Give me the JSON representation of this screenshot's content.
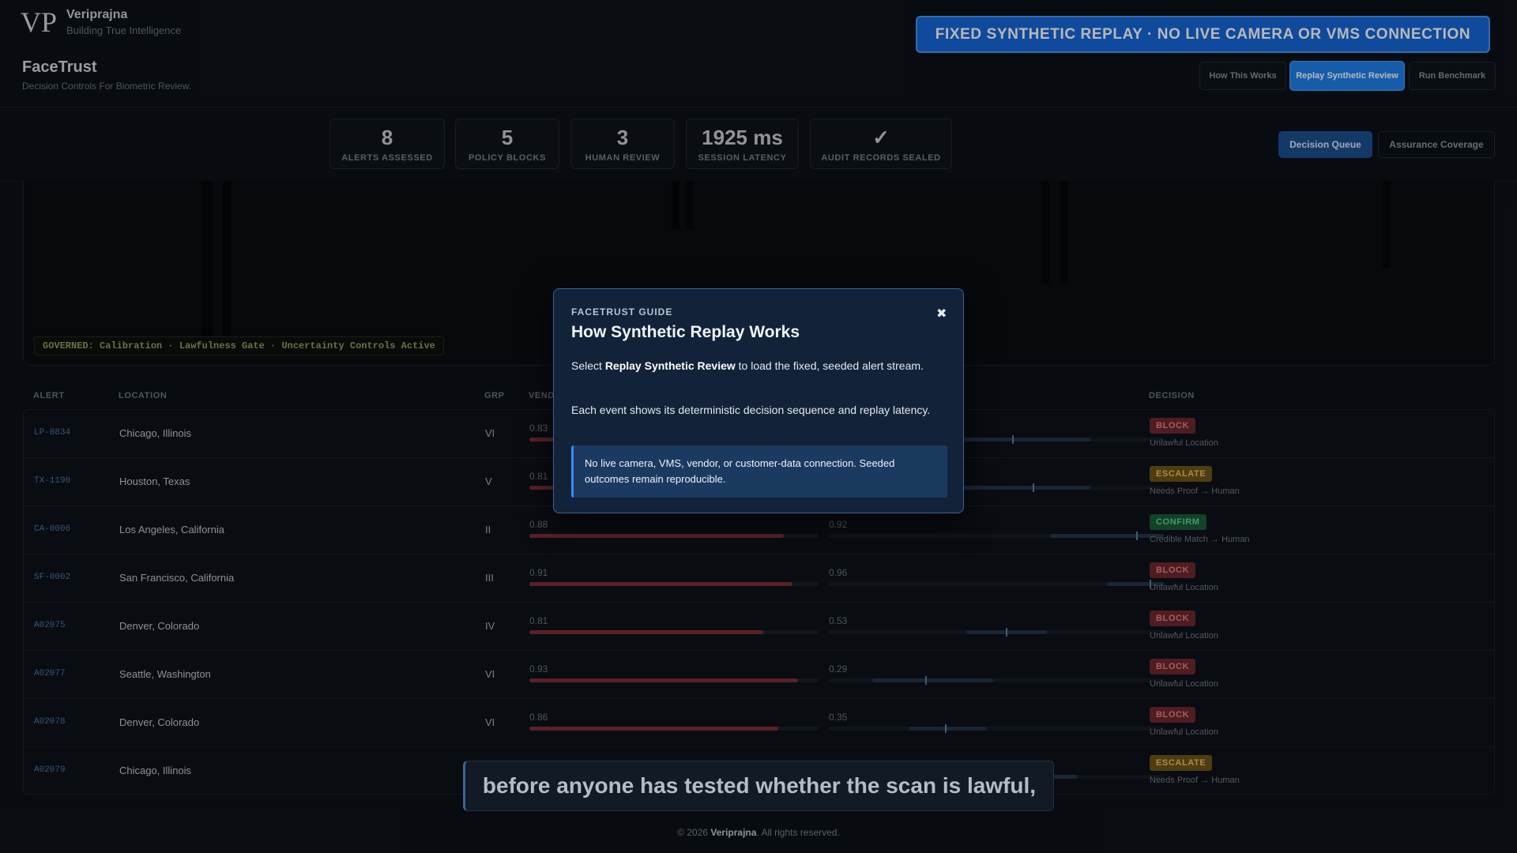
{
  "brand": {
    "name": "Veriprajna",
    "tagline": "Building True Intelligence",
    "logo_text": "VP"
  },
  "notice": "FIXED SYNTHETIC REPLAY · NO LIVE CAMERA OR VMS CONNECTION",
  "app": {
    "title": "FaceTrust",
    "subtitle": "Decision Controls For Biometric Review."
  },
  "top_nav": {
    "how": "How This Works",
    "replay": "Replay Synthetic Review",
    "bench": "Run Benchmark"
  },
  "stats": [
    {
      "value": "8",
      "label": "ALERTS ASSESSED"
    },
    {
      "value": "5",
      "label": "POLICY BLOCKS"
    },
    {
      "value": "3",
      "label": "HUMAN REVIEW"
    },
    {
      "value": "1925 ms",
      "label": "SESSION LATENCY"
    },
    {
      "value": "✓",
      "label": "AUDIT RECORDS SEALED"
    }
  ],
  "views": {
    "queue": "Decision Queue",
    "coverage": "Assurance Coverage"
  },
  "governed": "GOVERNED: Calibration · Lawfulness Gate · Uncertainty Controls Active",
  "table": {
    "headers": {
      "alert": "ALERT",
      "location": "LOCATION",
      "grp": "GRP",
      "vendor": "VEND",
      "decision": "DECISION"
    },
    "rows": [
      {
        "id": "LP-0834",
        "location": "Chicago, Illinois",
        "grp": "VI",
        "vendor": 0.83,
        "vendor_text": "0.83",
        "unc_text": "",
        "unc": 0.55,
        "unc_range": [
          0.3,
          0.78
        ],
        "decision": "BLOCK",
        "kind": "block",
        "reason": "Unlawful Location"
      },
      {
        "id": "TX-1190",
        "location": "Houston, Texas",
        "grp": "V",
        "vendor": 0.81,
        "vendor_text": "0.81",
        "unc_text": "",
        "unc": 0.61,
        "unc_range": [
          0.4,
          0.78
        ],
        "decision": "ESCALATE",
        "kind": "escalate",
        "reason": "Needs Proof → Human"
      },
      {
        "id": "CA-0006",
        "location": "Los Angeles, California",
        "grp": "II",
        "vendor": 0.88,
        "vendor_text": "0.88",
        "unc_text": "0.92",
        "unc": 0.92,
        "unc_range": [
          0.66,
          1.0
        ],
        "decision": "CONFIRM",
        "kind": "confirm",
        "reason": "Credible Match → Human"
      },
      {
        "id": "SF-0002",
        "location": "San Francisco, California",
        "grp": "III",
        "vendor": 0.91,
        "vendor_text": "0.91",
        "unc_text": "0.96",
        "unc": 0.96,
        "unc_range": [
          0.83,
          1.0
        ],
        "decision": "BLOCK",
        "kind": "block",
        "reason": "Unlawful Location"
      },
      {
        "id": "A02075",
        "location": "Denver, Colorado",
        "grp": "IV",
        "vendor": 0.81,
        "vendor_text": "0.81",
        "unc_text": "0.53",
        "unc": 0.53,
        "unc_range": [
          0.41,
          0.65
        ],
        "decision": "BLOCK",
        "kind": "block",
        "reason": "Unlawful Location"
      },
      {
        "id": "A02077",
        "location": "Seattle, Washington",
        "grp": "VI",
        "vendor": 0.93,
        "vendor_text": "0.93",
        "unc_text": "0.29",
        "unc": 0.29,
        "unc_range": [
          0.13,
          0.49
        ],
        "decision": "BLOCK",
        "kind": "block",
        "reason": "Unlawful Location"
      },
      {
        "id": "A02078",
        "location": "Denver, Colorado",
        "grp": "VI",
        "vendor": 0.86,
        "vendor_text": "0.86",
        "unc_text": "0.35",
        "unc": 0.35,
        "unc_range": [
          0.24,
          0.47
        ],
        "decision": "BLOCK",
        "kind": "block",
        "reason": "Unlawful Location"
      },
      {
        "id": "A02079",
        "location": "Chicago, Illinois",
        "grp": "",
        "vendor": null,
        "vendor_text": "",
        "unc_text": "",
        "unc": null,
        "unc_range": [
          0.6,
          0.74
        ],
        "decision": "ESCALATE",
        "kind": "escalate",
        "reason": "Needs Proof → Human"
      }
    ]
  },
  "guide": {
    "kicker": "FACETRUST GUIDE",
    "title": "How Synthetic Replay Works",
    "p1_pre": "Select ",
    "p1_bold": "Replay Synthetic Review",
    "p1_post": " to load the fixed, seeded alert stream.",
    "p2": "Each event shows its deterministic decision sequence and replay latency.",
    "note": "No live camera, VMS, vendor, or customer-data connection. Seeded outcomes remain reproducible.",
    "close": "✖"
  },
  "caption": "before anyone has tested whether the scan is lawful,",
  "footer": {
    "pre": "© 2026 ",
    "brand": "Veriprajna",
    "post": ". All rights reserved."
  },
  "colors": {
    "accent": "#1e82ee",
    "notice": "#1767d8",
    "block": "#ef7d86",
    "escalate": "#efc15a",
    "confirm": "#5fd491"
  }
}
